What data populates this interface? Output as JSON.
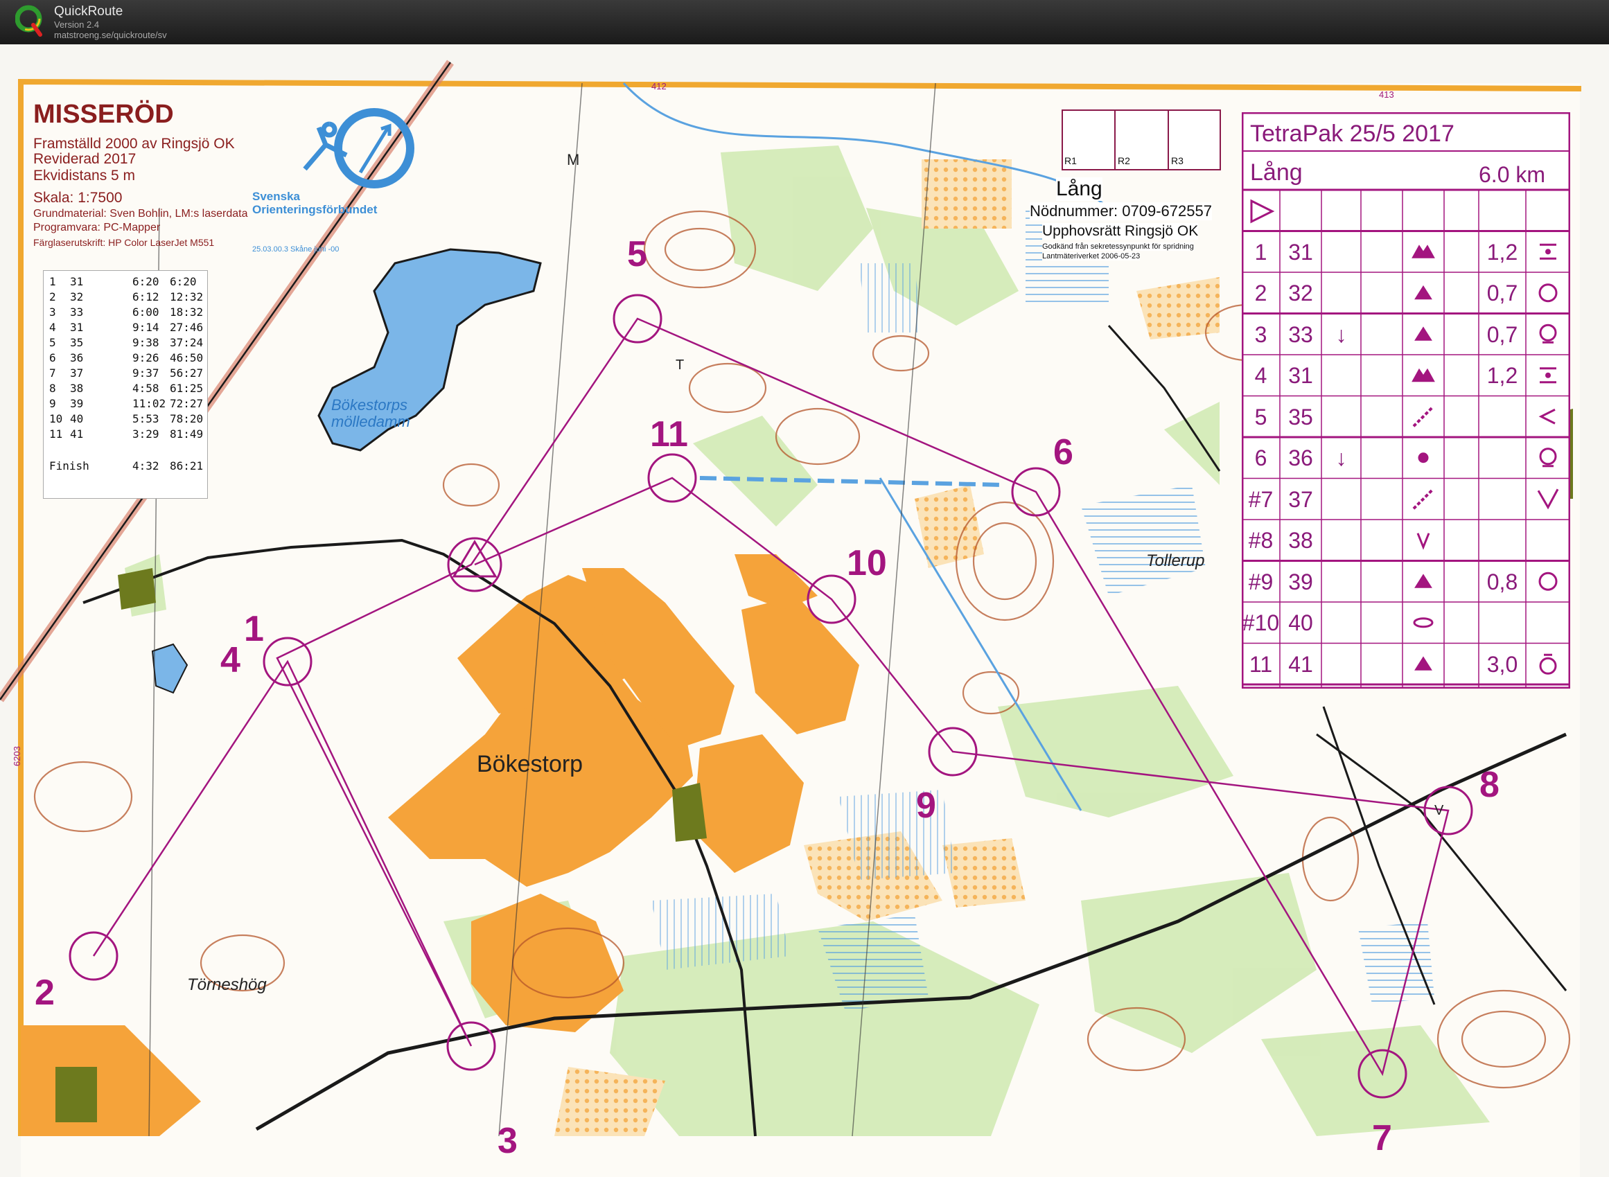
{
  "app": {
    "name": "QuickRoute",
    "version": "Version 2.4",
    "url": "matstroeng.se/quickroute/sv"
  },
  "map_header": {
    "title": "MISSERÖD",
    "lines": [
      "Framställd 2000 av Ringsjö OK",
      "Reviderad 2017",
      "Ekvidistans 5 m",
      "Skala:  1:7500"
    ],
    "small_lines": [
      "Grundmaterial: Sven Bohlin, LM:s laserdata",
      "Programvara: PC-Mapper",
      "Färglaserutskrift: HP Color LaserJet M551"
    ],
    "federation": [
      "Svenska",
      "Orienteringsförbundet"
    ],
    "federation_date": "25.03.00.3 Skåne juni -00"
  },
  "rights": {
    "r_labels": [
      "R1",
      "R2",
      "R3"
    ],
    "course": "Lång",
    "emergency": "Nödnummer: 0709-672557",
    "copyright": "Upphovsrätt Ringsjö OK",
    "approval": "Godkänd från sekretessynpunkt för spridning",
    "approval2": "Lantmäteriverket 2006-05-23"
  },
  "grid_labels": [
    "412",
    "413",
    "6203"
  ],
  "splits": {
    "rows": [
      {
        "n": "1",
        "code": "31",
        "leg": "6:20",
        "total": "6:20"
      },
      {
        "n": "2",
        "code": "32",
        "leg": "6:12",
        "total": "12:32"
      },
      {
        "n": "3",
        "code": "33",
        "leg": "6:00",
        "total": "18:32"
      },
      {
        "n": "4",
        "code": "31",
        "leg": "9:14",
        "total": "27:46"
      },
      {
        "n": "5",
        "code": "35",
        "leg": "9:38",
        "total": "37:24"
      },
      {
        "n": "6",
        "code": "36",
        "leg": "9:26",
        "total": "46:50"
      },
      {
        "n": "7",
        "code": "37",
        "leg": "9:37",
        "total": "56:27"
      },
      {
        "n": "8",
        "code": "38",
        "leg": "4:58",
        "total": "61:25"
      },
      {
        "n": "9",
        "code": "39",
        "leg": "11:02",
        "total": "72:27"
      },
      {
        "n": "10",
        "code": "40",
        "leg": "5:53",
        "total": "78:20"
      },
      {
        "n": "11",
        "code": "41",
        "leg": "3:29",
        "total": "81:49"
      }
    ],
    "finish_label": "Finish",
    "finish_leg": "4:32",
    "finish_total": "86:21"
  },
  "course_card": {
    "event": "TetraPak 25/5 2017",
    "course": "Lång",
    "length": "6.0 km",
    "controls": [
      {
        "num": "1",
        "code": "31",
        "dir": "",
        "feature": "knolls",
        "dim": "1,2",
        "pos": "between"
      },
      {
        "num": "2",
        "code": "32",
        "dir": "",
        "feature": "knoll",
        "dim": "0,7",
        "pos": "ring"
      },
      {
        "num": "3",
        "code": "33",
        "dir": "↓",
        "feature": "knoll",
        "dim": "0,7",
        "pos": "ring-foot"
      },
      {
        "num": "4",
        "code": "31",
        "dir": "",
        "feature": "knolls",
        "dim": "1,2",
        "pos": "between"
      },
      {
        "num": "5",
        "code": "35",
        "dir": "",
        "feature": "ditch",
        "dim": "",
        "pos": "bend"
      },
      {
        "num": "6",
        "code": "36",
        "dir": "↓",
        "feature": "dot",
        "dim": "",
        "pos": "ring-foot"
      },
      {
        "num": "#7",
        "code": "37",
        "dir": "",
        "feature": "ditch",
        "dim": "",
        "pos": "junction"
      },
      {
        "num": "#8",
        "code": "38",
        "dir": "",
        "feature": "depression",
        "dim": "",
        "pos": ""
      },
      {
        "num": "#9",
        "code": "39",
        "dir": "",
        "feature": "knoll",
        "dim": "0,8",
        "pos": "ring"
      },
      {
        "num": "#10",
        "code": "40",
        "dir": "",
        "feature": "ellipse",
        "dim": "",
        "pos": ""
      },
      {
        "num": "11",
        "code": "41",
        "dir": "",
        "feature": "knoll",
        "dim": "3,0",
        "pos": "ring-top"
      }
    ]
  },
  "place_names": [
    "Bökestorps",
    "mölledamm",
    "Bökestorp",
    "Törneshög",
    "Tollerup",
    "M",
    "T",
    "V"
  ],
  "control_labels": [
    "1",
    "2",
    "3",
    "4",
    "5",
    "6",
    "7",
    "8",
    "9",
    "10",
    "11"
  ],
  "colors": {
    "course": "#a3157f",
    "water": "#5aa2e0",
    "open_land": "#f5a33a",
    "forest_green": "#c9e7a8",
    "contour": "#b4552a",
    "border_orange": "#f0a830"
  }
}
